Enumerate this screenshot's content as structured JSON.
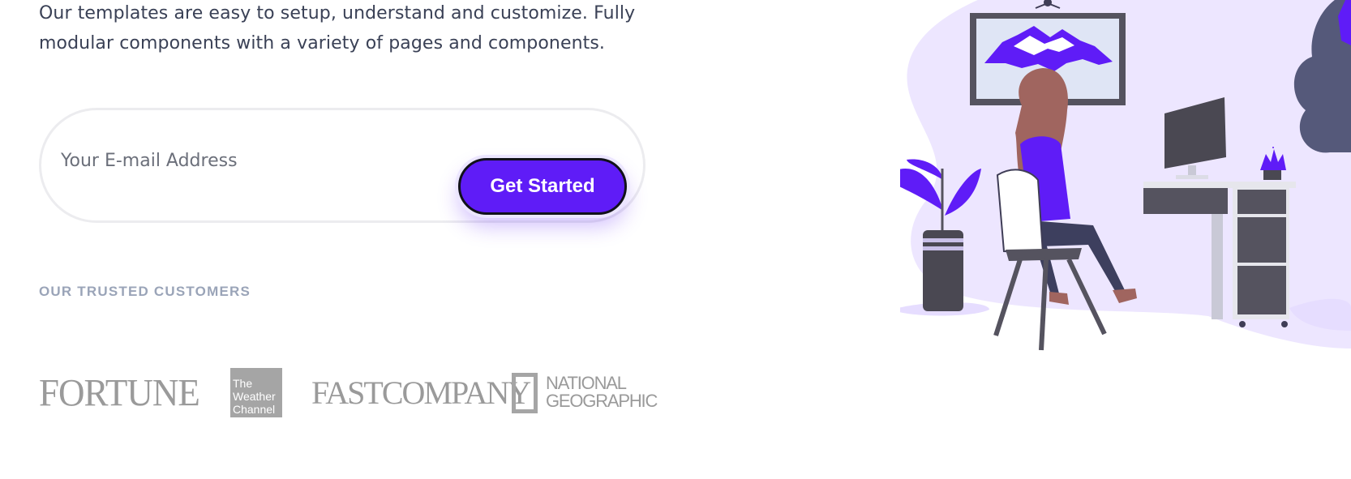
{
  "hero": {
    "lead_line1": "Our templates are easy to setup, understand and customize. Fully",
    "lead_line2": "modular components with a variety of pages and components."
  },
  "signup": {
    "email_placeholder": "Your E-mail Address",
    "email_value": "",
    "button_label": "Get Started"
  },
  "customers": {
    "label": "OUR TRUSTED CUSTOMERS",
    "logos": {
      "fortune": "FORTUNE",
      "weather_line1": "The",
      "weather_line2": "Weather",
      "weather_line3": "Channel",
      "fastcompany": "FASTCOMPANY",
      "natgeo_line1": "NATIONAL",
      "natgeo_line2": "GEOGRAPHIC"
    }
  },
  "colors": {
    "accent": "#5f1cf7",
    "text": "#3a4156",
    "muted": "#9aa4b8",
    "logo_gray": "#9a9a9a"
  }
}
